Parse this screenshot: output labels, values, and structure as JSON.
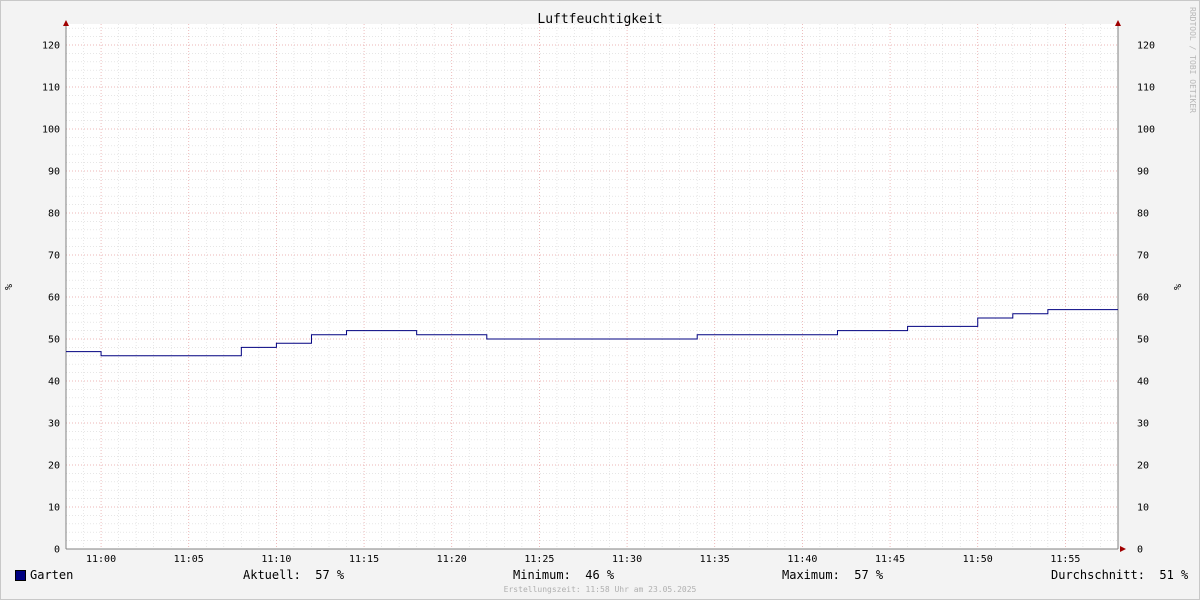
{
  "chart_data": {
    "type": "line",
    "title": "Luftfeuchtigkeit",
    "ylabel": "%",
    "ylim": [
      0,
      125
    ],
    "y_ticks": [
      0,
      10,
      20,
      30,
      40,
      50,
      60,
      70,
      80,
      90,
      100,
      110,
      120
    ],
    "x_ticks": [
      "11:00",
      "11:05",
      "11:10",
      "11:15",
      "11:20",
      "11:25",
      "11:30",
      "11:35",
      "11:40",
      "11:45",
      "11:50",
      "11:55"
    ],
    "xlim": [
      "10:58",
      "11:58"
    ],
    "grid": true,
    "legend_placement": "bottom-left",
    "series": [
      {
        "name": "Garten",
        "color": "#000080",
        "points": [
          [
            "10:58",
            47
          ],
          [
            "11:00",
            46
          ],
          [
            "11:08",
            48
          ],
          [
            "11:10",
            49
          ],
          [
            "11:12",
            51
          ],
          [
            "11:14",
            52
          ],
          [
            "11:18",
            51
          ],
          [
            "11:22",
            50
          ],
          [
            "11:34",
            51
          ],
          [
            "11:42",
            52
          ],
          [
            "11:46",
            53
          ],
          [
            "11:50",
            55
          ],
          [
            "11:52",
            56
          ],
          [
            "11:54",
            57
          ],
          [
            "11:58",
            57
          ]
        ]
      }
    ],
    "watermark": "RRDTOOL / TOBI OETIKER"
  },
  "legend": {
    "series_name": "Garten",
    "swatch_color": "#000080",
    "current_label": "Aktuell:",
    "current_value": "57 %",
    "min_label": "Minimum:",
    "min_value": "46 %",
    "max_label": "Maximum:",
    "max_value": "57 %",
    "avg_label": "Durchschnitt:",
    "avg_value": "51 %"
  },
  "footer": "Erstellungszeit: 11:58 Uhr am 23.05.2025"
}
